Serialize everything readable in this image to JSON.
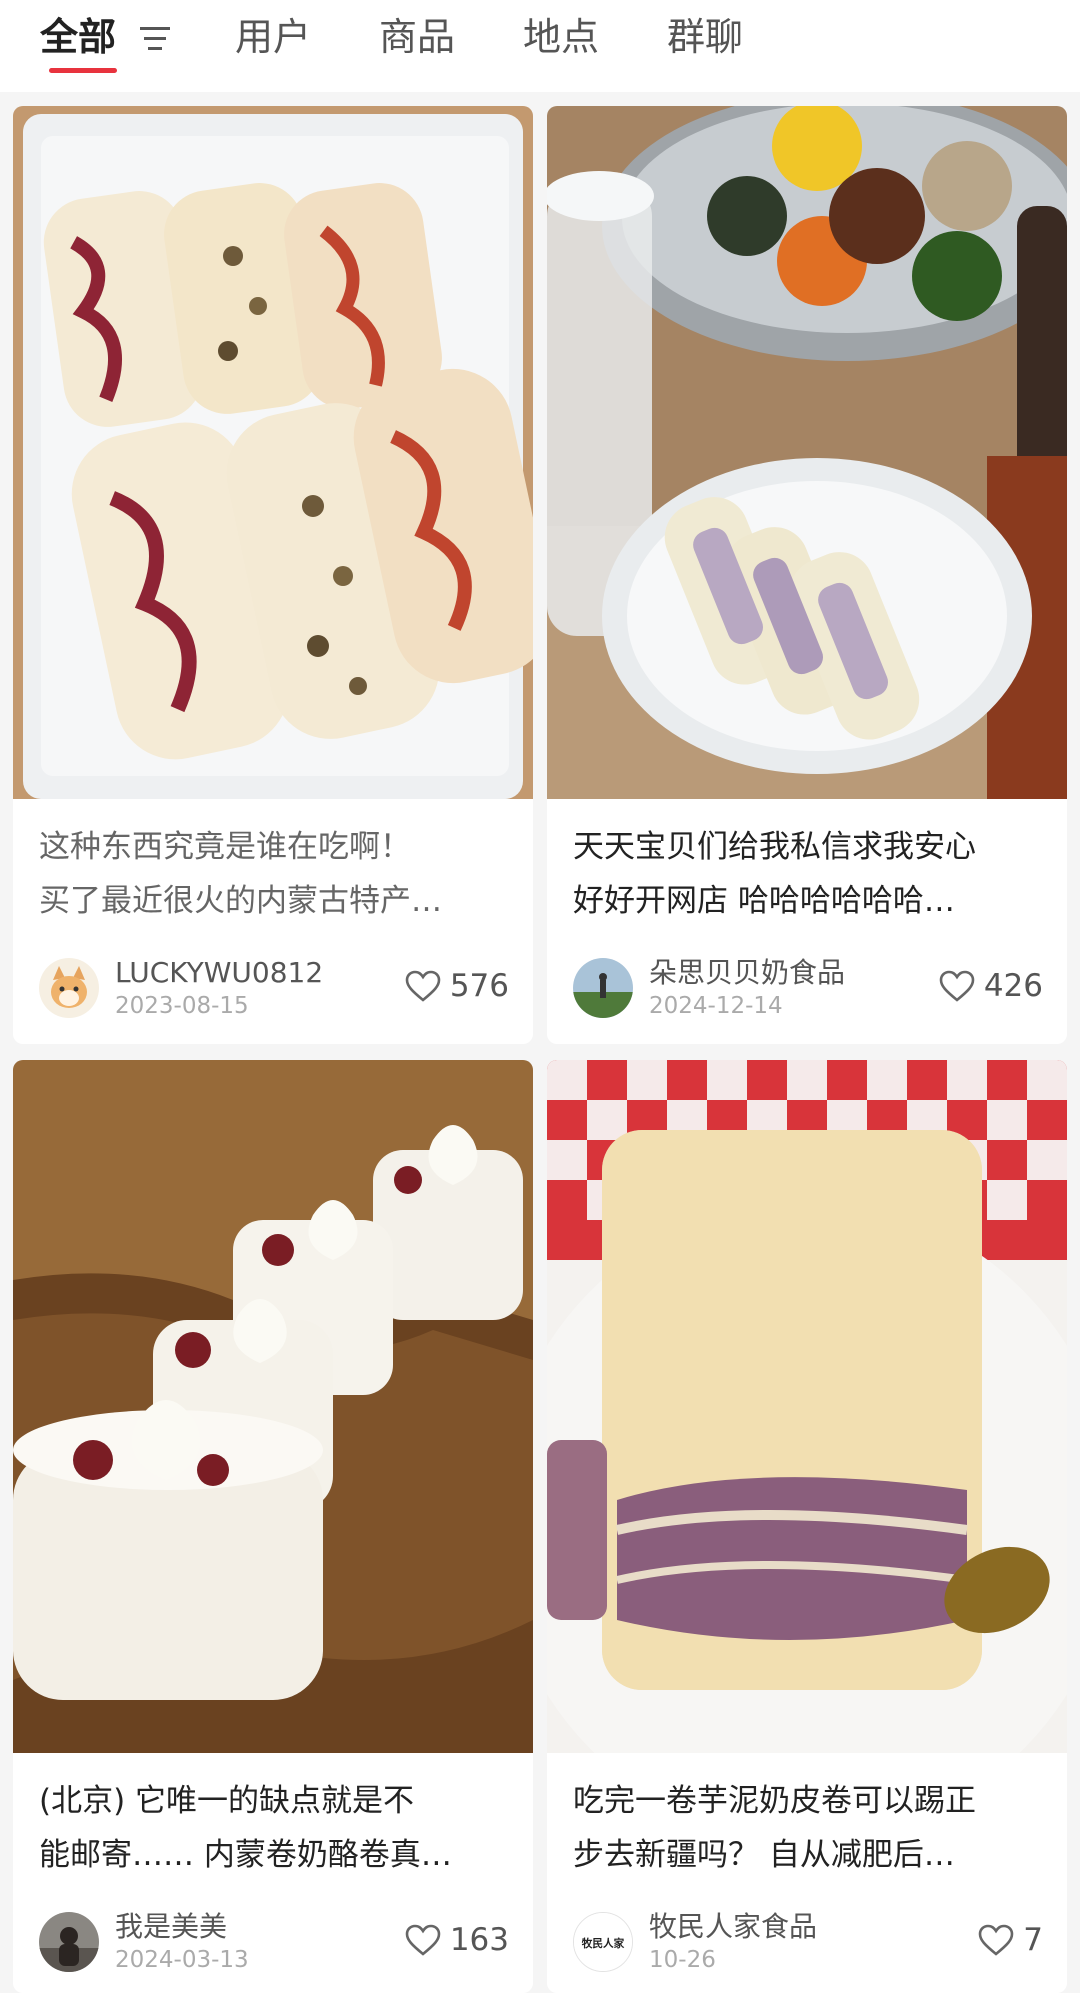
{
  "tabs": [
    {
      "label": "全部",
      "active": true
    },
    {
      "label": "用户"
    },
    {
      "label": "商品"
    },
    {
      "label": "地点"
    },
    {
      "label": "群聊"
    }
  ],
  "posts": [
    {
      "title_line1": "这种东西究竟是谁在吃啊！",
      "title_line2": "买了最近很火的内蒙古特产…",
      "author": "LUCKYWU0812",
      "date": "2023-08-15",
      "likes": "576",
      "image": "cheese-rolls-in-plastic-tray"
    },
    {
      "title_line1": "天天宝贝们给我私信求我安心",
      "title_line2": "好好开网店 哈哈哈哈哈哈…",
      "author": "朵思贝贝奶食品",
      "date": "2024-12-14",
      "likes": "426",
      "image": "taro-rolls-in-bowl-with-bibimbap"
    },
    {
      "title_line1": "(北京) 它唯一的缺点就是不",
      "title_line2": "能邮寄…… 内蒙卷奶酪卷真…",
      "author": "我是美美",
      "date": "2024-03-13",
      "likes": "163",
      "image": "cheese-rolls-on-wooden-board"
    },
    {
      "title_line1": "吃完一卷芋泥奶皮卷可以踢正",
      "title_line2": "步去新疆吗？ 自从减肥后…",
      "author": "牧民人家食品",
      "date": "10-26",
      "likes": "7",
      "image": "taro-milk-skin-roll-on-plate",
      "avatar_text": "牧民人家"
    }
  ],
  "colors": {
    "accent": "#e8333e"
  }
}
